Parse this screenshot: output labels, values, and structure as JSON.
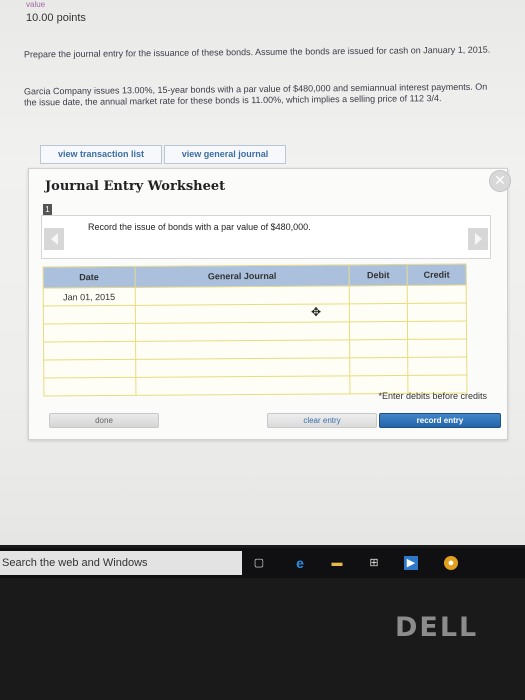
{
  "header": {
    "value_label": "value",
    "points": "10.00 points"
  },
  "question": {
    "prompt": "Prepare the journal entry for the issuance of these bonds. Assume the bonds are issued for cash on January 1, 2015.",
    "scenario": "Garcia Company issues 13.00%, 15-year bonds with a par value of $480,000 and semiannual interest payments. On the issue date, the annual market rate for these bonds is 11.00%, which implies a selling price of 112 3/4."
  },
  "tabs": {
    "transaction_list": "view transaction list",
    "general_journal": "view general journal"
  },
  "worksheet": {
    "title": "Journal Entry Worksheet",
    "step_number": "1",
    "description": "Record the issue of bonds with a par value of $480,000.",
    "columns": [
      "Date",
      "General Journal",
      "Debit",
      "Credit"
    ],
    "rows": [
      [
        "Jan 01, 2015",
        "",
        "",
        ""
      ],
      [
        "",
        "",
        "",
        ""
      ],
      [
        "",
        "",
        "",
        ""
      ],
      [
        "",
        "",
        "",
        ""
      ],
      [
        "",
        "",
        "",
        ""
      ],
      [
        "",
        "",
        "",
        ""
      ]
    ],
    "note": "*Enter debits before credits",
    "buttons": {
      "done": "done",
      "clear": "clear entry",
      "record": "record entry"
    }
  },
  "taskbar": {
    "search_placeholder": "Search the web and Windows",
    "icons": [
      "task-view-icon",
      "edge-icon",
      "file-explorer-icon",
      "store-icon",
      "media-icon",
      "chrome-icon"
    ]
  },
  "bezel": {
    "brand": "DELL"
  }
}
